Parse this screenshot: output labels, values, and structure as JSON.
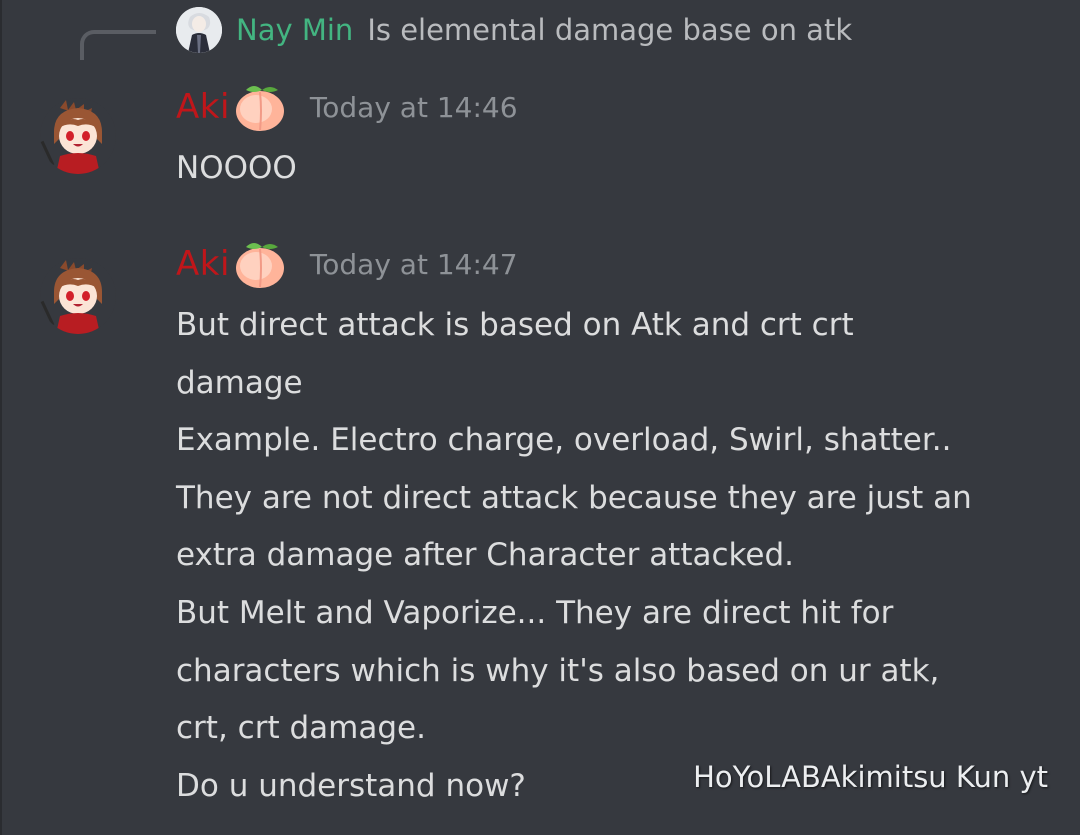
{
  "colors": {
    "background": "#36393f",
    "reply_author": "#43b581",
    "author": "#c0161a",
    "timestamp": "#8e9297",
    "text": "#dcddde",
    "muted_text": "#b9bbbe"
  },
  "reply": {
    "author": "Nay Min",
    "text": "Is elemental damage base on atk"
  },
  "messages": [
    {
      "author": "Aki",
      "author_emoji": "peach-icon",
      "timestamp": "Today at 14:46",
      "lines": [
        "NOOOO"
      ]
    },
    {
      "author": "Aki",
      "author_emoji": "peach-icon",
      "timestamp": "Today at 14:47",
      "lines": [
        "But direct attack is based on Atk and crt crt",
        "damage",
        "Example. Electro charge, overload, Swirl, shatter..",
        "They are not direct attack because they are just an",
        "extra damage after Character attacked.",
        "But Melt and Vaporize... They are direct hit for",
        "characters which is why it's also based on ur atk,",
        "crt, crt damage.",
        "Do u understand now?"
      ]
    }
  ],
  "watermark": "HoYoLABAkimitsu Kun yt"
}
